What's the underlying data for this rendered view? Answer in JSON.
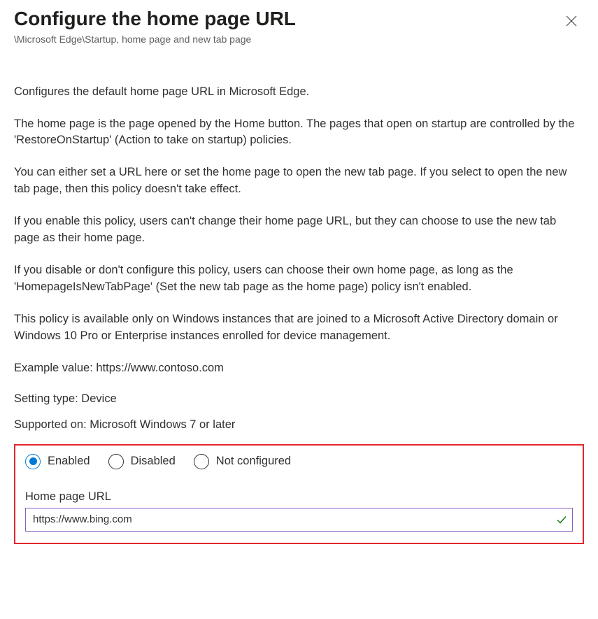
{
  "header": {
    "title": "Configure the home page URL",
    "breadcrumb": "\\Microsoft Edge\\Startup, home page and new tab page"
  },
  "description": {
    "p1": "Configures the default home page URL in Microsoft Edge.",
    "p2": "The home page is the page opened by the Home button. The pages that open on startup are controlled by the 'RestoreOnStartup' (Action to take on startup) policies.",
    "p3": "You can either set a URL here or set the home page to open the new tab page. If you select to open the new tab page, then this policy doesn't take effect.",
    "p4": "If you enable this policy, users can't change their home page URL, but they can choose to use the new tab page as their home page.",
    "p5": "If you disable or don't configure this policy, users can choose their own home page, as long as the 'HomepageIsNewTabPage' (Set the new tab page as the home page) policy isn't enabled.",
    "p6": "This policy is available only on Windows instances that are joined to a Microsoft Active Directory domain or Windows 10 Pro or Enterprise instances enrolled for device management.",
    "example": "Example value: https://www.contoso.com"
  },
  "meta": {
    "setting_type": "Setting type: Device",
    "supported_on": "Supported on: Microsoft Windows 7 or later"
  },
  "options": {
    "enabled": "Enabled",
    "disabled": "Disabled",
    "not_configured": "Not configured",
    "selected": "enabled"
  },
  "field": {
    "label": "Home page URL",
    "value": "https://www.bing.com"
  }
}
